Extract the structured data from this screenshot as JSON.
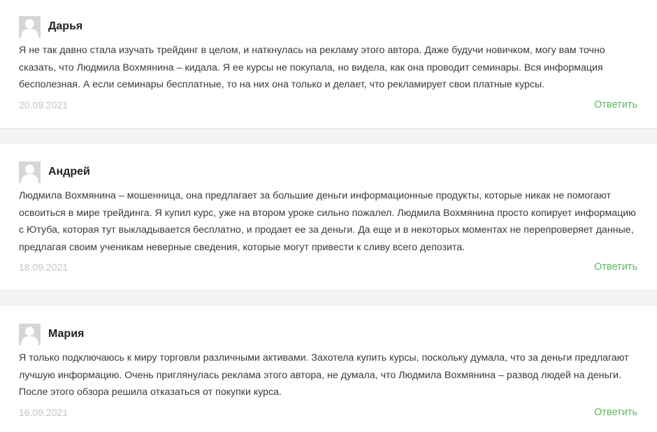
{
  "comments": [
    {
      "author": "Дарья",
      "text": "Я не так давно стала изучать трейдинг в целом, и наткнулась на рекламу этого автора. Даже будучи новичком, могу вам точно сказать, что Людмила Вохмянина – кидала. Я ее курсы не покупала, но видела, как она проводит семинары. Вся информация бесполезная. А если семинары бесплатные, то на них она только и делает, что рекламирует свои платные курсы.",
      "date": "20.09.2021",
      "reply_label": "Ответить",
      "avatar_icon": "user-placeholder-icon"
    },
    {
      "author": "Андрей",
      "text": "Людмила Вохмянина – мошенница, она предлагает за большие деньги информационные продукты, которые никак не помогают освоиться в мире трейдинга. Я купил курс, уже на втором уроке сильно пожалел. Людмила Вохмянина просто копирует информацию с Ютуба, которая тут выкладывается бесплатно, и продает ее за деньги. Да еще и в некоторых моментах не перепроверяет данные, предлагая своим ученикам неверные сведения, которые могут привести к сливу всего депозита.",
      "date": "18.09.2021",
      "reply_label": "Ответить",
      "avatar_icon": "user-placeholder-icon"
    },
    {
      "author": "Мария",
      "text": "Я только подключаюсь к миру торговли различными активами. Захотела купить курсы, поскольку думала, что за деньги предлагают лучшую информацию. Очень приглянулась реклама этого автора, не думала, что Людмила Вохмянина – развод людей на деньги. После этого обзора решила отказаться от покупки курса.",
      "date": "16.09.2021",
      "reply_label": "Ответить",
      "avatar_icon": "user-placeholder-icon"
    }
  ],
  "colors": {
    "reply_link": "#5cb85c",
    "date": "#c4c4c4",
    "separator": "#f4f4f4",
    "avatar_bg": "#d6d6d6"
  }
}
